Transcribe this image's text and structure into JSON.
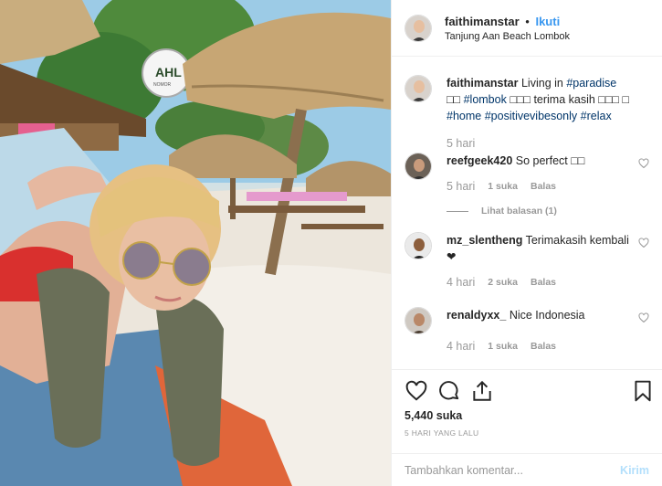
{
  "post": {
    "username": "faithimanstar",
    "follow_label": "Ikuti",
    "dot": "•",
    "location": "Tanjung Aan Beach Lombok",
    "photo_sign_text": "AHL",
    "photo_sign_sub": "NOMOR"
  },
  "caption": {
    "username": "faithimanstar",
    "text_before": "Living in ",
    "tag1": "#paradise",
    "emoji1": " □□",
    "tag2": "#lombok",
    "mid_text": " □□□ terima kasih □□□ □",
    "tag3": "#home",
    "tag4": "#positivevibesonly",
    "tag5": "#relax",
    "time": "5 hari"
  },
  "comments": [
    {
      "username": "reefgeek420",
      "text": "So perfect □□",
      "time": "5 hari",
      "likes": "1 suka",
      "reply": "Balas",
      "view_replies": "Lihat balasan (1)"
    },
    {
      "username": "mz_slentheng",
      "text": "Terimakasih kembali❤",
      "time": "4 hari",
      "likes": "2 suka",
      "reply": "Balas"
    },
    {
      "username": "renaldyxx_",
      "text": "Nice Indonesia",
      "time": "4 hari",
      "likes": "1 suka",
      "reply": "Balas"
    }
  ],
  "actions": {
    "likes_count": "5,440 suka",
    "posted_ago": "5 HARI YANG LALU"
  },
  "add_comment": {
    "placeholder": "Tambahkan komentar...",
    "post_label": "Kirim"
  },
  "icons": {
    "like": "heart-icon",
    "comment": "comment-icon",
    "share": "share-icon",
    "save": "bookmark-icon",
    "comment_like": "heart-icon"
  },
  "colors": {
    "link": "#3897f0",
    "hashtag": "#003569",
    "muted": "#999999",
    "post_disabled": "#b2dffc"
  }
}
